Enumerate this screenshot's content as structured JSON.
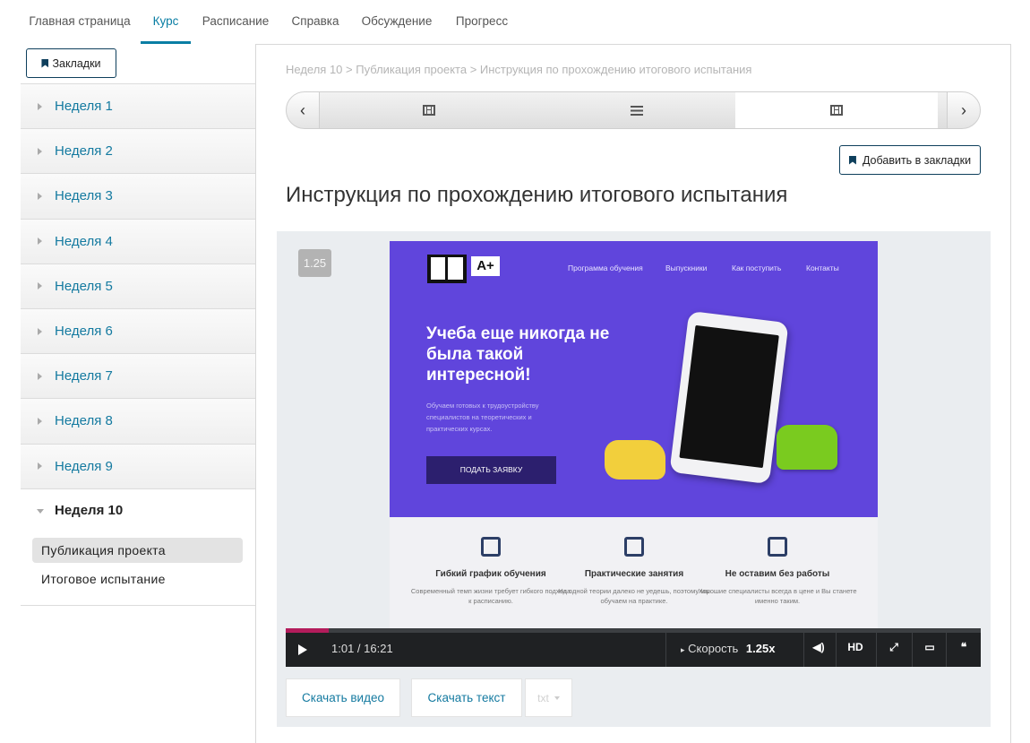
{
  "topnav": {
    "tabs": [
      {
        "label": "Главная страница",
        "active": false
      },
      {
        "label": "Курс",
        "active": true
      },
      {
        "label": "Расписание",
        "active": false
      },
      {
        "label": "Справка",
        "active": false
      },
      {
        "label": "Обсуждение",
        "active": false
      },
      {
        "label": "Прогресс",
        "active": false
      }
    ]
  },
  "sidebar": {
    "bookmarks_label": "Закладки",
    "weeks": [
      "Неделя 1",
      "Неделя 2",
      "Неделя 3",
      "Неделя 4",
      "Неделя 5",
      "Неделя 6",
      "Неделя 7",
      "Неделя 8",
      "Неделя 9"
    ],
    "open_week": {
      "title": "Неделя 10",
      "items": [
        "Публикация проекта",
        "Итоговое испытание"
      ]
    }
  },
  "breadcrumb": "Неделя 10 > Публикация проекта > Инструкция по прохождению итогового испытания",
  "add_bookmark_label": "Добавить в закладки",
  "page_title": "Инструкция по прохождению итогового испытания",
  "video": {
    "speed_badge": "1.25",
    "time": "1:01 / 16:21",
    "progress_fraction": 0.062,
    "speed_label": "Скорость",
    "speed_value": "1.25x",
    "hd_label": "HD",
    "screenshot": {
      "logo_text": "A+",
      "nav": [
        "Программа обучения",
        "Выпускники",
        "Как поступить",
        "Контакты"
      ],
      "headline": "Учеба еще никогда не была такой интересной!",
      "subtext": "Обучаем готовых к трудоустройству специалистов на теоретических и практических курсах.",
      "cta": "ПОДАТЬ ЗАЯВКУ",
      "features": [
        {
          "title": "Гибкий график обучения",
          "text": "Современный темп жизни требует гибкого подхода к расписанию."
        },
        {
          "title": "Практические занятия",
          "text": "На одной теории далеко не уедешь, поэтому мы обучаем на практике."
        },
        {
          "title": "Не оставим без работы",
          "text": "Хорошие специалисты всегда в цене и Вы станете именно таким."
        }
      ]
    }
  },
  "downloads": {
    "video_label": "Скачать видео",
    "text_label": "Скачать текст",
    "format": "txt"
  },
  "colors": {
    "accent": "#0a7ea4",
    "hero_purple": "#6045dc",
    "progress": "#b31c5b"
  }
}
